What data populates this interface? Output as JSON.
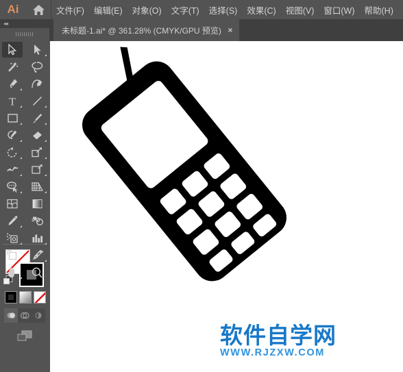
{
  "app": {
    "logo_text": "Ai",
    "home_icon": "home-icon"
  },
  "menubar": {
    "items": [
      {
        "label": "文件(F)",
        "name": "menu-file"
      },
      {
        "label": "编辑(E)",
        "name": "menu-edit"
      },
      {
        "label": "对象(O)",
        "name": "menu-object"
      },
      {
        "label": "文字(T)",
        "name": "menu-type"
      },
      {
        "label": "选择(S)",
        "name": "menu-select"
      },
      {
        "label": "效果(C)",
        "name": "menu-effect"
      },
      {
        "label": "视图(V)",
        "name": "menu-view"
      },
      {
        "label": "窗口(W)",
        "name": "menu-window"
      },
      {
        "label": "帮助(H)",
        "name": "menu-help"
      }
    ]
  },
  "tabbar": {
    "document_title": "未标题-1.ai* @ 361.28% (CMYK/GPU 预览)",
    "close_label": "×"
  },
  "panel": {
    "collapse_icon": "◂◂"
  },
  "toolbar": {
    "tools": [
      {
        "name": "selection-tool",
        "active": true,
        "corner": false
      },
      {
        "name": "direct-selection-tool",
        "active": false,
        "corner": true
      },
      {
        "name": "magic-wand-tool",
        "active": false,
        "corner": false
      },
      {
        "name": "lasso-tool",
        "active": false,
        "corner": false
      },
      {
        "name": "pen-tool",
        "active": false,
        "corner": true
      },
      {
        "name": "curvature-tool",
        "active": false,
        "corner": false
      },
      {
        "name": "type-tool",
        "active": false,
        "corner": true
      },
      {
        "name": "line-segment-tool",
        "active": false,
        "corner": true
      },
      {
        "name": "rectangle-tool",
        "active": false,
        "corner": true
      },
      {
        "name": "paintbrush-tool",
        "active": false,
        "corner": true
      },
      {
        "name": "shaper-tool",
        "active": false,
        "corner": true
      },
      {
        "name": "eraser-tool",
        "active": false,
        "corner": true
      },
      {
        "name": "rotate-tool",
        "active": false,
        "corner": true
      },
      {
        "name": "scale-tool",
        "active": false,
        "corner": true
      },
      {
        "name": "width-tool",
        "active": false,
        "corner": true
      },
      {
        "name": "free-transform-tool",
        "active": false,
        "corner": true
      },
      {
        "name": "shape-builder-tool",
        "active": false,
        "corner": true
      },
      {
        "name": "perspective-grid-tool",
        "active": false,
        "corner": true
      },
      {
        "name": "mesh-tool",
        "active": false,
        "corner": false
      },
      {
        "name": "gradient-tool",
        "active": false,
        "corner": false
      },
      {
        "name": "eyedropper-tool",
        "active": false,
        "corner": true
      },
      {
        "name": "blend-tool",
        "active": false,
        "corner": false
      },
      {
        "name": "symbol-sprayer-tool",
        "active": false,
        "corner": true
      },
      {
        "name": "column-graph-tool",
        "active": false,
        "corner": true
      },
      {
        "name": "artboard-tool",
        "active": false,
        "corner": false
      },
      {
        "name": "slice-tool",
        "active": false,
        "corner": true
      },
      {
        "name": "hand-tool",
        "active": false,
        "corner": true
      },
      {
        "name": "zoom-tool",
        "active": false,
        "corner": false
      }
    ],
    "fill_stroke": {
      "fill_name": "fill-swatch",
      "fill_value": "none",
      "stroke_name": "stroke-swatch",
      "stroke_value": "#000000",
      "swap_icon": "swap-fill-stroke-icon",
      "default_icon": "default-fill-stroke-icon"
    },
    "color_modes": [
      {
        "name": "color-button",
        "selected": true
      },
      {
        "name": "gradient-button",
        "selected": false
      },
      {
        "name": "none-button",
        "selected": false
      }
    ],
    "draw_modes": [
      {
        "name": "draw-normal-button",
        "selected": true
      },
      {
        "name": "draw-behind-button",
        "selected": false
      },
      {
        "name": "draw-inside-button",
        "selected": false
      }
    ],
    "screen_mode": {
      "name": "change-screen-mode-button"
    }
  },
  "canvas": {
    "artwork_name": "mobile-phone-silhouette",
    "background": "#ffffff",
    "fill_color": "#000000",
    "screen_color": "#ffffff",
    "keypad_rows": 4,
    "keypad_cols": 3
  },
  "watermark": {
    "title": "软件自学网",
    "url": "WWW.RJZXW.COM",
    "color": "#1878c8"
  }
}
